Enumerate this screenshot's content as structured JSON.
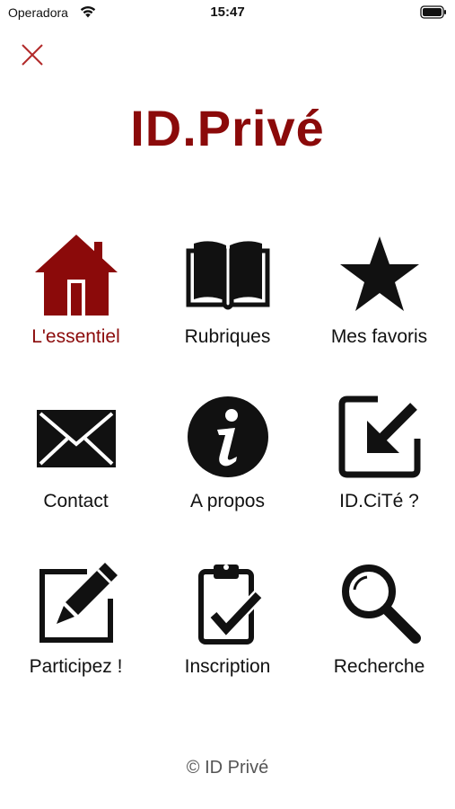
{
  "status_bar": {
    "carrier": "Operadora",
    "time": "15:47",
    "icons": [
      "wifi-icon",
      "battery-icon"
    ]
  },
  "app": {
    "title": "ID.Privé",
    "brand_color": "#8b0a0a"
  },
  "menu": {
    "items": [
      {
        "label": "L'essentiel",
        "icon": "house-icon",
        "active": true
      },
      {
        "label": "Rubriques",
        "icon": "open-book-icon",
        "active": false
      },
      {
        "label": "Mes favoris",
        "icon": "star-icon",
        "active": false
      },
      {
        "label": "Contact",
        "icon": "envelope-icon",
        "active": false
      },
      {
        "label": "A propos",
        "icon": "info-icon",
        "active": false
      },
      {
        "label": "ID.CiTé ?",
        "icon": "arrow-in-box-icon",
        "active": false
      },
      {
        "label": "Participez !",
        "icon": "edit-pencil-icon",
        "active": false
      },
      {
        "label": "Inscription",
        "icon": "clipboard-check-icon",
        "active": false
      },
      {
        "label": "Recherche",
        "icon": "magnifier-icon",
        "active": false
      }
    ]
  },
  "footer": {
    "copyright": "© ID Privé"
  }
}
